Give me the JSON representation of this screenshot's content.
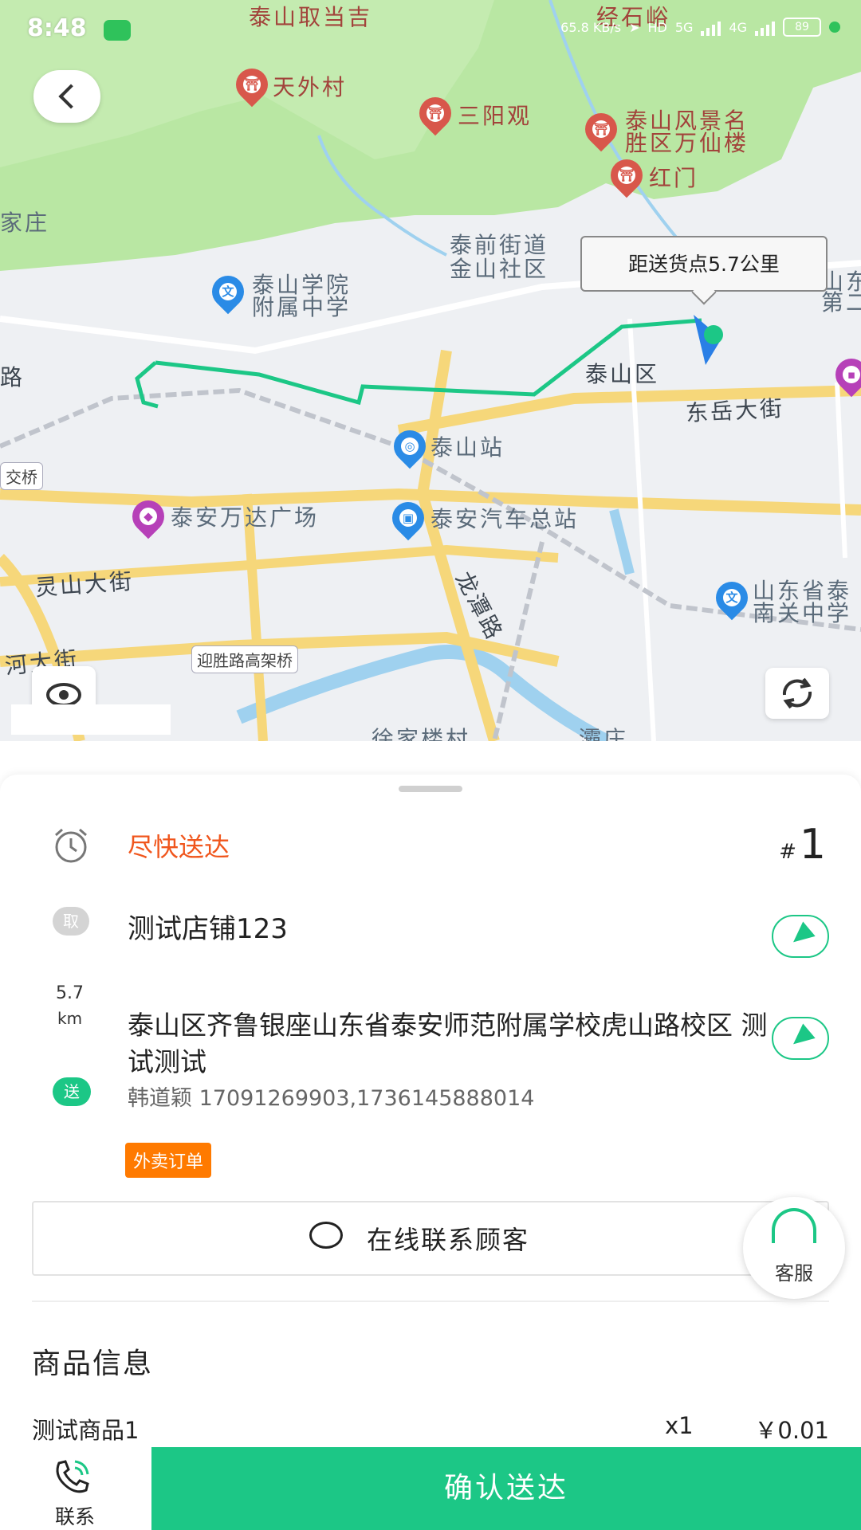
{
  "status_bar": {
    "time": "8:48",
    "net_speed": "65.8 KB/s",
    "hd_label": "HD",
    "net_5g": "5G",
    "net_4g": "4G",
    "battery": "89"
  },
  "map": {
    "distance_bubble": "距送货点5.7公里",
    "labels": {
      "tianwaicun": "天外村",
      "sanyangguan": "三阳观",
      "scenic_1": "泰山风景名",
      "scenic_2": "胜区万仙楼",
      "hongmen": "红门",
      "jiazhuang": "家庄",
      "taiqian_1": "泰前街道",
      "taiqian_2": "金山社区",
      "school_1": "泰山学院",
      "school_2": "附属中学",
      "taishan_district": "泰山区",
      "shandong_partial_1": "山东",
      "shandong_partial_2": "第二",
      "lu": "路",
      "dongyue": "东岳大街",
      "taishan_station": "泰山站",
      "jiaoqiao": "交桥",
      "wanda": "泰安万达广场",
      "bus_station": "泰安汽车总站",
      "lingshan": "灵山大街",
      "longtan": "龙潭路",
      "nanguan_1": "山东省泰",
      "nanguan_2": "南关中学",
      "hedajie": "河大街",
      "yingsheng": "迎胜路高架桥",
      "xujialou": "徐家楼村",
      "top_1": "泰山取当吉",
      "top_2": "经石峪",
      "zhuang": "灞庄"
    }
  },
  "order": {
    "urgency": "尽快送达",
    "order_hash": "#",
    "order_number": "1",
    "pickup_badge": "取",
    "store_name": "测试店铺123",
    "distance_value": "5.7",
    "distance_unit": "km",
    "address": "泰山区齐鲁银座山东省泰安师范附属学校虎山路校区 测试测试",
    "deliver_badge": "送",
    "contact": "韩道颖 17091269903,1736145888014",
    "order_type": "外卖订单",
    "chat_button": "在线联系顾客",
    "service_label": "客服",
    "goods_title": "商品信息",
    "goods": [
      {
        "name": "测试商品1",
        "qty": "x1",
        "price": "￥0.01"
      }
    ]
  },
  "action_bar": {
    "contact_label": "联系",
    "confirm_label": "确认送达"
  },
  "colors": {
    "accent": "#1cc786",
    "urgent": "#f0561d",
    "order_type_bg": "#ff7a00",
    "route": "#1cc786"
  },
  "icons": [
    "back-icon",
    "locate-icon",
    "refresh-icon",
    "alarm-clock-icon",
    "navigate-icon",
    "chat-icon",
    "headset-icon",
    "phone-icon"
  ]
}
